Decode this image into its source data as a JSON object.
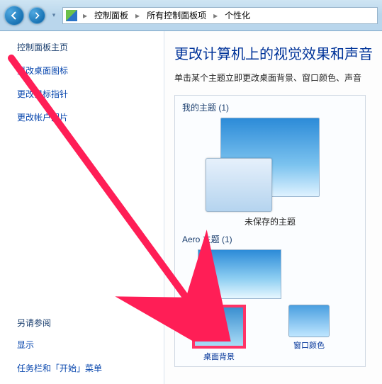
{
  "breadcrumbs": {
    "b1": "控制面板",
    "b2": "所有控制面板项",
    "b3": "个性化"
  },
  "sidebar": {
    "title": "控制面板主页",
    "links": {
      "desktop_icons": "更改桌面图标",
      "mouse_pointers": "更改鼠标指针",
      "account_picture": "更改帐户图片"
    },
    "see_also_header": "另请参阅",
    "see_also": {
      "display": "显示",
      "taskbar": "任务栏和「开始」菜单"
    }
  },
  "content": {
    "heading": "更改计算机上的视觉效果和声音",
    "sub": "单击某个主题立即更改桌面背景、窗口颜色、声音",
    "my_themes_header": "我的主题 (1)",
    "unsaved_theme_label": "未保存的主题",
    "aero_header": "Aero 主题 (1)",
    "swatch1_label": "桌面背景",
    "swatch2_label": "窗口颜色"
  }
}
